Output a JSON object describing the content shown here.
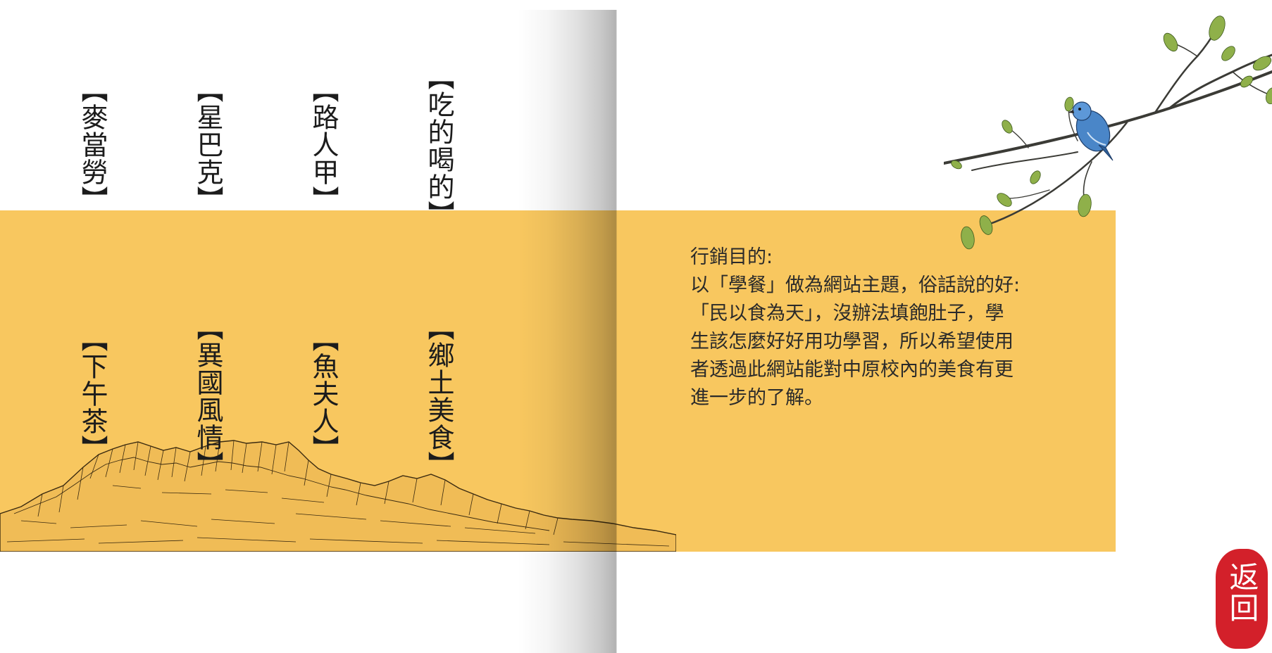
{
  "menu": {
    "top_row": [
      {
        "id": "eat-drink",
        "label": "【吃的喝的】"
      },
      {
        "id": "passerby",
        "label": "【路人甲】"
      },
      {
        "id": "starbucks",
        "label": "【星巴克】"
      },
      {
        "id": "mcdonalds",
        "label": "【麥當勞】"
      }
    ],
    "bottom_row": [
      {
        "id": "local-food",
        "label": "【鄉土美食】"
      },
      {
        "id": "fishermans-wife",
        "label": "【魚夫人】"
      },
      {
        "id": "exotic-style",
        "label": "【異國風情】"
      },
      {
        "id": "afternoon-tea",
        "label": "【下午茶】"
      }
    ]
  },
  "description": {
    "text": "行銷目的:\n以「學餐」做為網站主題，俗話說的好:\n「民以食為天」，沒辦法填飽肚子，學\n生該怎麼好好用功學習，所以希望使用\n者透過此網站能對中原校內的美食有更\n進一步的了解。"
  },
  "back_button": {
    "label": "返回"
  },
  "colors": {
    "band": "#f8c75f",
    "seal": "#d3202a",
    "text": "#1c1c1c"
  },
  "decorations": {
    "branch": "branch-with-bird-illustration",
    "mountains": "mountain-sketch-illustration"
  }
}
